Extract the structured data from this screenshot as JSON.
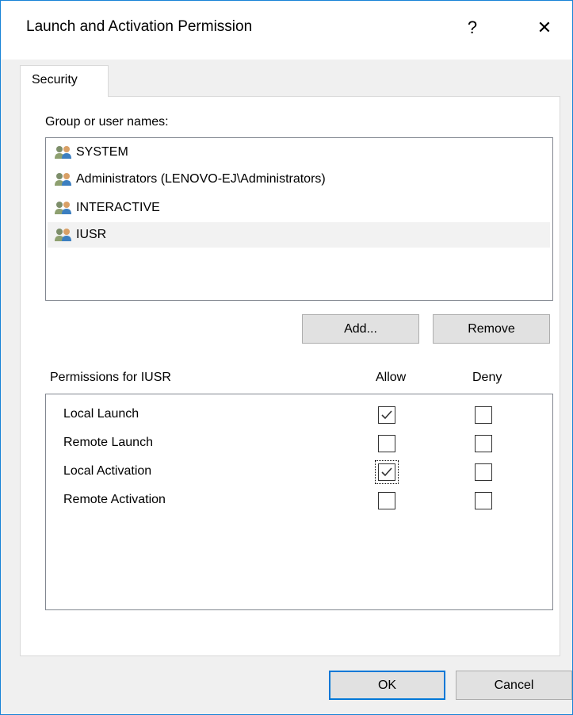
{
  "window": {
    "title": "Launch and Activation Permission",
    "help_glyph": "?",
    "close_glyph": "✕"
  },
  "tabs": [
    {
      "label": "Security",
      "active": true
    }
  ],
  "security": {
    "group_label": "Group or user names:",
    "users": [
      {
        "name": "SYSTEM",
        "icon": "users-icon",
        "selected": false
      },
      {
        "name": "Administrators (LENOVO-EJ\\Administrators)",
        "icon": "users-icon",
        "selected": false
      },
      {
        "name": "INTERACTIVE",
        "icon": "users-icon",
        "selected": false
      },
      {
        "name": "IUSR",
        "icon": "users-icon",
        "selected": true
      }
    ],
    "add_label": "Add...",
    "remove_label": "Remove",
    "permissions_label": "Permissions for IUSR",
    "allow_header": "Allow",
    "deny_header": "Deny",
    "permissions": [
      {
        "name": "Local Launch",
        "allow": true,
        "deny": false
      },
      {
        "name": "Remote Launch",
        "allow": false,
        "deny": false
      },
      {
        "name": "Local Activation",
        "allow": true,
        "deny": false,
        "focused": true
      },
      {
        "name": "Remote Activation",
        "allow": false,
        "deny": false
      }
    ]
  },
  "footer": {
    "ok_label": "OK",
    "cancel_label": "Cancel"
  },
  "colors": {
    "accent": "#0078d7",
    "window_border": "#1883d7",
    "dialog_bg": "#f0f0f0",
    "selection_bg": "#f2f2f2"
  }
}
